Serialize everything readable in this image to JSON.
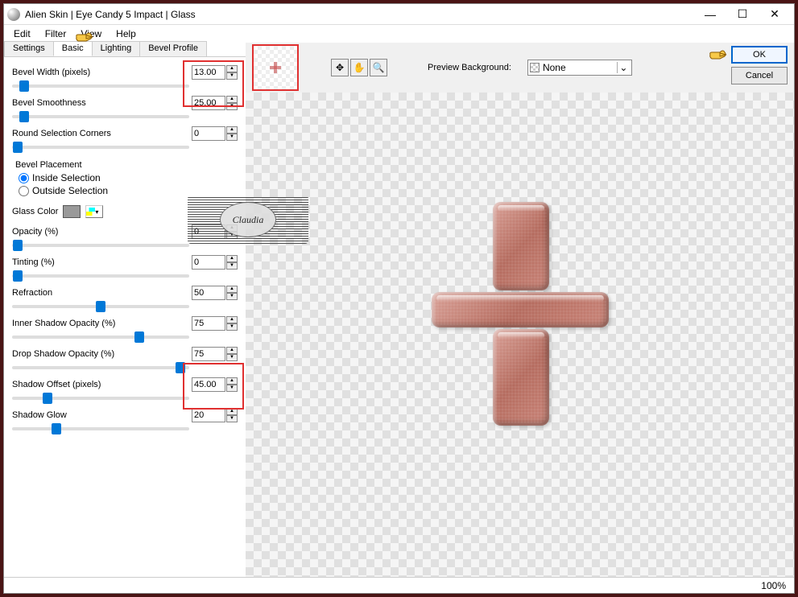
{
  "window": {
    "title": "Alien Skin | Eye Candy 5 Impact | Glass",
    "controls": {
      "min": "—",
      "max": "☐",
      "close": "✕"
    }
  },
  "menu": {
    "items": [
      "Edit",
      "Filter",
      "View",
      "Help"
    ]
  },
  "tabs": {
    "items": [
      "Settings",
      "Basic",
      "Lighting",
      "Bevel Profile"
    ],
    "active": 1
  },
  "params": {
    "bevel_width": {
      "label": "Bevel Width (pixels)",
      "value": "13.00",
      "pos": 7
    },
    "bevel_smoothness": {
      "label": "Bevel Smoothness",
      "value": "25.00",
      "pos": 7
    },
    "round_corners": {
      "label": "Round Selection Corners",
      "value": "0",
      "pos": 3
    },
    "bevel_placement": {
      "label": "Bevel Placement",
      "inside": "Inside Selection",
      "outside": "Outside Selection"
    },
    "glass_color": {
      "label": "Glass Color"
    },
    "opacity": {
      "label": "Opacity (%)",
      "value": "0",
      "pos": 3
    },
    "tinting": {
      "label": "Tinting (%)",
      "value": "0",
      "pos": 3
    },
    "refraction": {
      "label": "Refraction",
      "value": "50",
      "pos": 50
    },
    "inner_shadow": {
      "label": "Inner Shadow Opacity (%)",
      "value": "75",
      "pos": 72
    },
    "drop_shadow": {
      "label": "Drop Shadow Opacity (%)",
      "value": "75",
      "pos": 95
    },
    "shadow_offset": {
      "label": "Shadow Offset (pixels)",
      "value": "45.00",
      "pos": 20
    },
    "shadow_glow": {
      "label": "Shadow Glow",
      "value": "20",
      "pos": 25
    }
  },
  "toolbar": {
    "preview_bg_label": "Preview Background:",
    "preview_bg_value": "None",
    "ok": "OK",
    "cancel": "Cancel"
  },
  "status": {
    "zoom": "100%"
  },
  "watermark": {
    "text": "Claudia"
  }
}
